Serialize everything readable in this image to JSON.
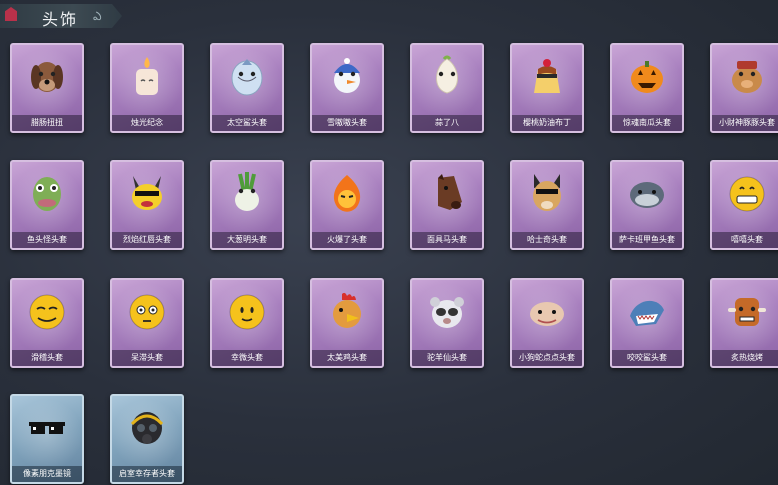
{
  "header": {
    "title": "头饰"
  },
  "items": [
    {
      "label": "腊肠扭扭",
      "icon": "dog-head-icon",
      "frame": "purple"
    },
    {
      "label": "烛光纪念",
      "icon": "candle-head-icon",
      "frame": "purple"
    },
    {
      "label": "太空鲨头套",
      "icon": "space-shark-head-icon",
      "frame": "purple"
    },
    {
      "label": "雪嗷嗷头套",
      "icon": "snowman-head-icon",
      "frame": "purple"
    },
    {
      "label": "蒜了八",
      "icon": "garlic-head-icon",
      "frame": "purple"
    },
    {
      "label": "樱桃奶油布丁",
      "icon": "pudding-head-icon",
      "frame": "purple"
    },
    {
      "label": "惊魂南瓜头套",
      "icon": "pumpkin-head-icon",
      "frame": "purple"
    },
    {
      "label": "小财神豚豚头套",
      "icon": "pig-head-icon",
      "frame": "purple"
    },
    {
      "label": "鱼头怪头套",
      "icon": "fish-monster-head-icon",
      "frame": "purple"
    },
    {
      "label": "烈焰红唇头套",
      "icon": "yellow-creature-head-icon",
      "frame": "purple"
    },
    {
      "label": "大葱明头套",
      "icon": "scallion-head-icon",
      "frame": "purple"
    },
    {
      "label": "火爆了头套",
      "icon": "fire-head-icon",
      "frame": "purple"
    },
    {
      "label": "面具马头套",
      "icon": "horse-head-icon",
      "frame": "purple"
    },
    {
      "label": "哈士奇头套",
      "icon": "husky-head-icon",
      "frame": "purple"
    },
    {
      "label": "萨卡班甲鱼头套",
      "icon": "armored-fish-head-icon",
      "frame": "purple"
    },
    {
      "label": "嘻嘻头套",
      "icon": "grin-emoji-head-icon",
      "frame": "purple"
    },
    {
      "label": "滑稽头套",
      "icon": "funny-emoji-head-icon",
      "frame": "purple"
    },
    {
      "label": "呆滞头套",
      "icon": "stare-emoji-head-icon",
      "frame": "purple"
    },
    {
      "label": "幸微头套",
      "icon": "smile-emoji-head-icon",
      "frame": "purple"
    },
    {
      "label": "太美鸡头套",
      "icon": "chicken-head-icon",
      "frame": "purple"
    },
    {
      "label": "驼羊仙头套",
      "icon": "alpaca-head-icon",
      "frame": "purple"
    },
    {
      "label": "小狗蛇点点头套",
      "icon": "snake-head-icon",
      "frame": "purple"
    },
    {
      "label": "咬咬鲨头套",
      "icon": "biting-shark-head-icon",
      "frame": "purple"
    },
    {
      "label": "炙热烧烤",
      "icon": "bbq-head-icon",
      "frame": "purple"
    },
    {
      "label": "像素朋克墨镜",
      "icon": "pixel-sunglasses-icon",
      "frame": "blue"
    },
    {
      "label": "启室幸存者头套",
      "icon": "gas-mask-helmet-icon",
      "frame": "blue"
    }
  ]
}
